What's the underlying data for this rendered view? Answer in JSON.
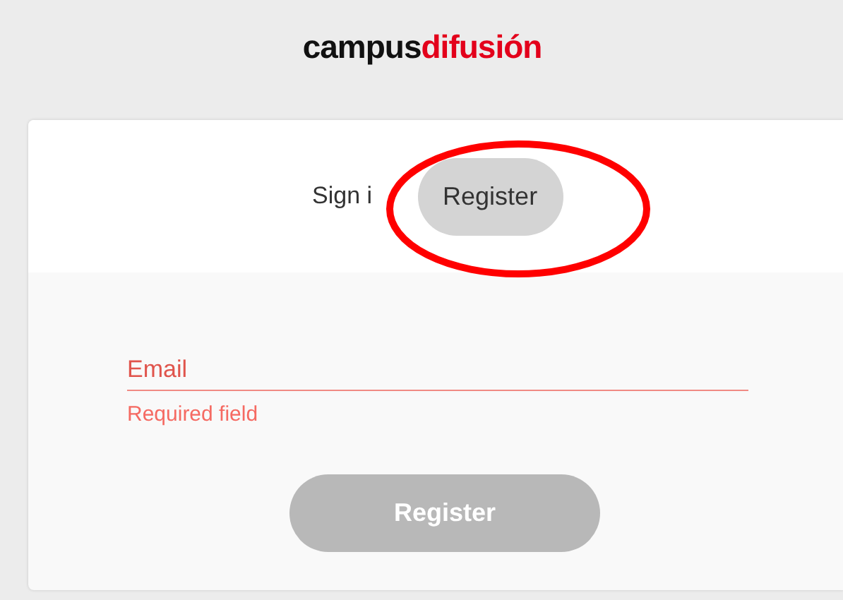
{
  "logo": {
    "parts": [
      "campus",
      "difusión"
    ]
  },
  "tabs": [
    {
      "label": "Sign i",
      "selected": false
    },
    {
      "label": "Register",
      "selected": true
    }
  ],
  "form": {
    "email": {
      "placeholder": "Email",
      "invalid": true,
      "error": "Required field"
    },
    "submit": {
      "label": "Register",
      "disabled": true
    }
  },
  "annotation": {
    "kind": "ellipse",
    "color": "#ff0000"
  }
}
